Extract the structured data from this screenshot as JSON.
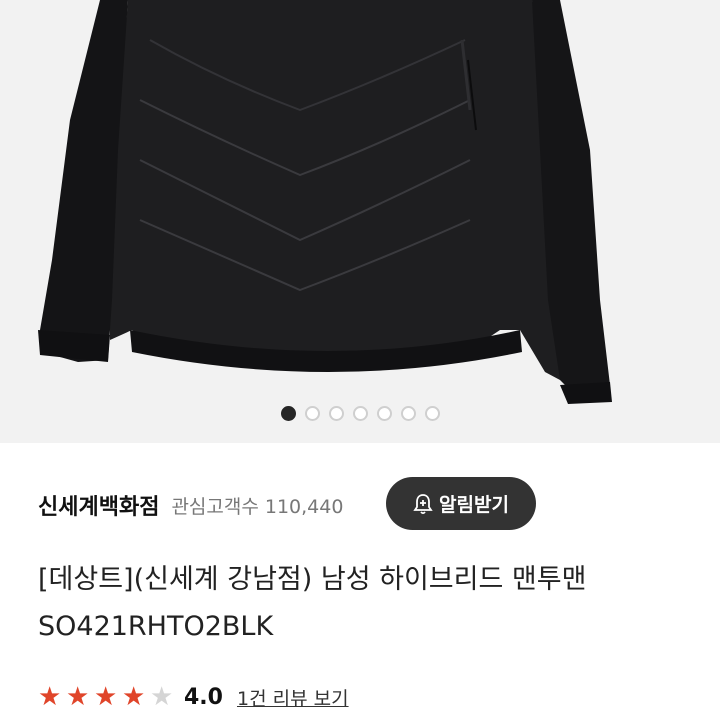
{
  "product_image": {
    "alt_icon": "black-hybrid-sweatshirt-image"
  },
  "carousel": {
    "total": 7,
    "active_index": 0
  },
  "seller": {
    "name": "신세계백화점",
    "followers_label": "관심고객수",
    "followers_count": "110,440",
    "alarm_button": "알림받기",
    "alarm_icon": "bell-plus-icon"
  },
  "product": {
    "title": "[데상트](신세계 강남점) 남성 하이브리드 맨투맨 SO421RHTO2BLK"
  },
  "rating": {
    "score": "4.0",
    "stars_filled": 4,
    "stars_total": 5,
    "review_link": "1건 리뷰 보기"
  },
  "colors": {
    "star": "#e0452a",
    "button": "#333333"
  }
}
